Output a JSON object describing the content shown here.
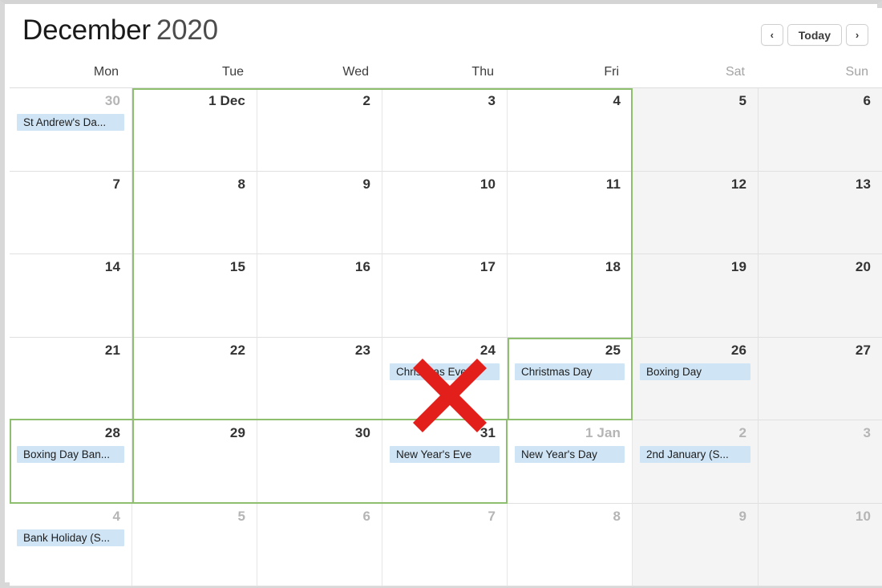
{
  "window": {
    "frame_color": "#d8d8d8"
  },
  "toolbar": {
    "title_month": "December",
    "title_year": "2020",
    "prev_label": "‹",
    "today_label": "Today",
    "next_label": "›"
  },
  "weekdays": [
    {
      "label": "Mon",
      "weekend": false
    },
    {
      "label": "Tue",
      "weekend": false
    },
    {
      "label": "Wed",
      "weekend": false
    },
    {
      "label": "Thu",
      "weekend": false
    },
    {
      "label": "Fri",
      "weekend": false
    },
    {
      "label": "Sat",
      "weekend": true
    },
    {
      "label": "Sun",
      "weekend": true
    }
  ],
  "colors": {
    "accent_green": "#8dbf6e",
    "event_chip_bg": "#cfe5f6",
    "weekend_bg": "#f4f4f4",
    "annotation_red": "#e31f1c"
  },
  "annotation": {
    "type": "red-x-mark",
    "on_day": "23",
    "color": "#e31f1c"
  },
  "weeks": [
    {
      "days": [
        {
          "num": "30",
          "other_month": true,
          "weekend": false,
          "events": [
            "St Andrew's Da..."
          ]
        },
        {
          "num": "1 Dec",
          "other_month": false,
          "weekend": false,
          "events": []
        },
        {
          "num": "2",
          "other_month": false,
          "weekend": false,
          "events": []
        },
        {
          "num": "3",
          "other_month": false,
          "weekend": false,
          "events": []
        },
        {
          "num": "4",
          "other_month": false,
          "weekend": false,
          "events": []
        },
        {
          "num": "5",
          "other_month": false,
          "weekend": true,
          "events": []
        },
        {
          "num": "6",
          "other_month": false,
          "weekend": true,
          "events": []
        }
      ]
    },
    {
      "days": [
        {
          "num": "7",
          "other_month": false,
          "weekend": false,
          "events": []
        },
        {
          "num": "8",
          "other_month": false,
          "weekend": false,
          "events": []
        },
        {
          "num": "9",
          "other_month": false,
          "weekend": false,
          "events": []
        },
        {
          "num": "10",
          "other_month": false,
          "weekend": false,
          "events": []
        },
        {
          "num": "11",
          "other_month": false,
          "weekend": false,
          "events": []
        },
        {
          "num": "12",
          "other_month": false,
          "weekend": true,
          "events": []
        },
        {
          "num": "13",
          "other_month": false,
          "weekend": true,
          "events": []
        }
      ]
    },
    {
      "days": [
        {
          "num": "14",
          "other_month": false,
          "weekend": false,
          "events": []
        },
        {
          "num": "15",
          "other_month": false,
          "weekend": false,
          "events": []
        },
        {
          "num": "16",
          "other_month": false,
          "weekend": false,
          "events": []
        },
        {
          "num": "17",
          "other_month": false,
          "weekend": false,
          "events": []
        },
        {
          "num": "18",
          "other_month": false,
          "weekend": false,
          "events": []
        },
        {
          "num": "19",
          "other_month": false,
          "weekend": true,
          "events": []
        },
        {
          "num": "20",
          "other_month": false,
          "weekend": true,
          "events": []
        }
      ]
    },
    {
      "days": [
        {
          "num": "21",
          "other_month": false,
          "weekend": false,
          "events": []
        },
        {
          "num": "22",
          "other_month": false,
          "weekend": false,
          "events": []
        },
        {
          "num": "23",
          "other_month": false,
          "weekend": false,
          "events": []
        },
        {
          "num": "24",
          "other_month": false,
          "weekend": false,
          "events": [
            "Christmas Eve"
          ]
        },
        {
          "num": "25",
          "other_month": false,
          "weekend": false,
          "events": [
            "Christmas Day"
          ]
        },
        {
          "num": "26",
          "other_month": false,
          "weekend": true,
          "events": [
            "Boxing Day"
          ]
        },
        {
          "num": "27",
          "other_month": false,
          "weekend": true,
          "events": []
        }
      ]
    },
    {
      "days": [
        {
          "num": "28",
          "other_month": false,
          "weekend": false,
          "events": [
            "Boxing Day Ban..."
          ]
        },
        {
          "num": "29",
          "other_month": false,
          "weekend": false,
          "events": []
        },
        {
          "num": "30",
          "other_month": false,
          "weekend": false,
          "events": []
        },
        {
          "num": "31",
          "other_month": false,
          "weekend": false,
          "events": [
            "New Year's Eve"
          ]
        },
        {
          "num": "1 Jan",
          "other_month": true,
          "weekend": false,
          "events": [
            "New Year's Day"
          ]
        },
        {
          "num": "2",
          "other_month": true,
          "weekend": true,
          "events": [
            "2nd January (S..."
          ]
        },
        {
          "num": "3",
          "other_month": true,
          "weekend": true,
          "events": []
        }
      ]
    },
    {
      "days": [
        {
          "num": "4",
          "other_month": true,
          "weekend": false,
          "events": [
            "Bank Holiday (S..."
          ]
        },
        {
          "num": "5",
          "other_month": true,
          "weekend": false,
          "events": []
        },
        {
          "num": "6",
          "other_month": true,
          "weekend": false,
          "events": []
        },
        {
          "num": "7",
          "other_month": true,
          "weekend": false,
          "events": []
        },
        {
          "num": "8",
          "other_month": true,
          "weekend": false,
          "events": []
        },
        {
          "num": "9",
          "other_month": true,
          "weekend": true,
          "events": []
        },
        {
          "num": "10",
          "other_month": true,
          "weekend": true,
          "events": []
        }
      ]
    }
  ]
}
